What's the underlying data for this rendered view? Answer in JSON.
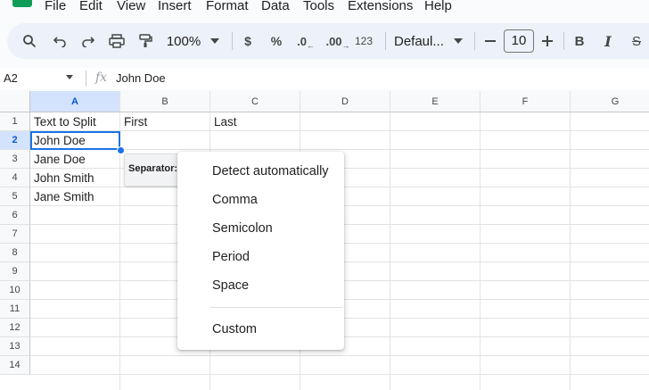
{
  "menubar": {
    "items": [
      "File",
      "Edit",
      "View",
      "Insert",
      "Format",
      "Data",
      "Tools",
      "Extensions",
      "Help"
    ]
  },
  "toolbar": {
    "zoom": "100%",
    "currency": "$",
    "percent": "%",
    "decrease_decimal": ".0",
    "increase_decimal": ".00",
    "number_format": "123",
    "font": "Defaul...",
    "font_size": "10",
    "bold": "B",
    "italic": "I",
    "strikethrough": "S"
  },
  "formula_bar": {
    "cell_ref": "A2",
    "fx": "fx",
    "value": "John Doe"
  },
  "grid": {
    "columns": [
      "A",
      "B",
      "C",
      "D",
      "E",
      "F",
      "G"
    ],
    "selected_column": "A",
    "rows": [
      "1",
      "2",
      "3",
      "4",
      "5",
      "6",
      "7",
      "8",
      "9",
      "10",
      "11",
      "12",
      "13",
      "14"
    ],
    "selected_row": "2",
    "cells": {
      "A1": "Text to Split",
      "B1": "First",
      "C1": "Last",
      "A2": "John Doe",
      "A3": "Jane Doe",
      "A4": "John Smith",
      "A5": "Jane Smith"
    }
  },
  "separator_chip": {
    "label": "Separator:"
  },
  "separator_menu": {
    "options": [
      "Detect automatically",
      "Comma",
      "Semicolon",
      "Period",
      "Space"
    ],
    "custom": "Custom"
  }
}
